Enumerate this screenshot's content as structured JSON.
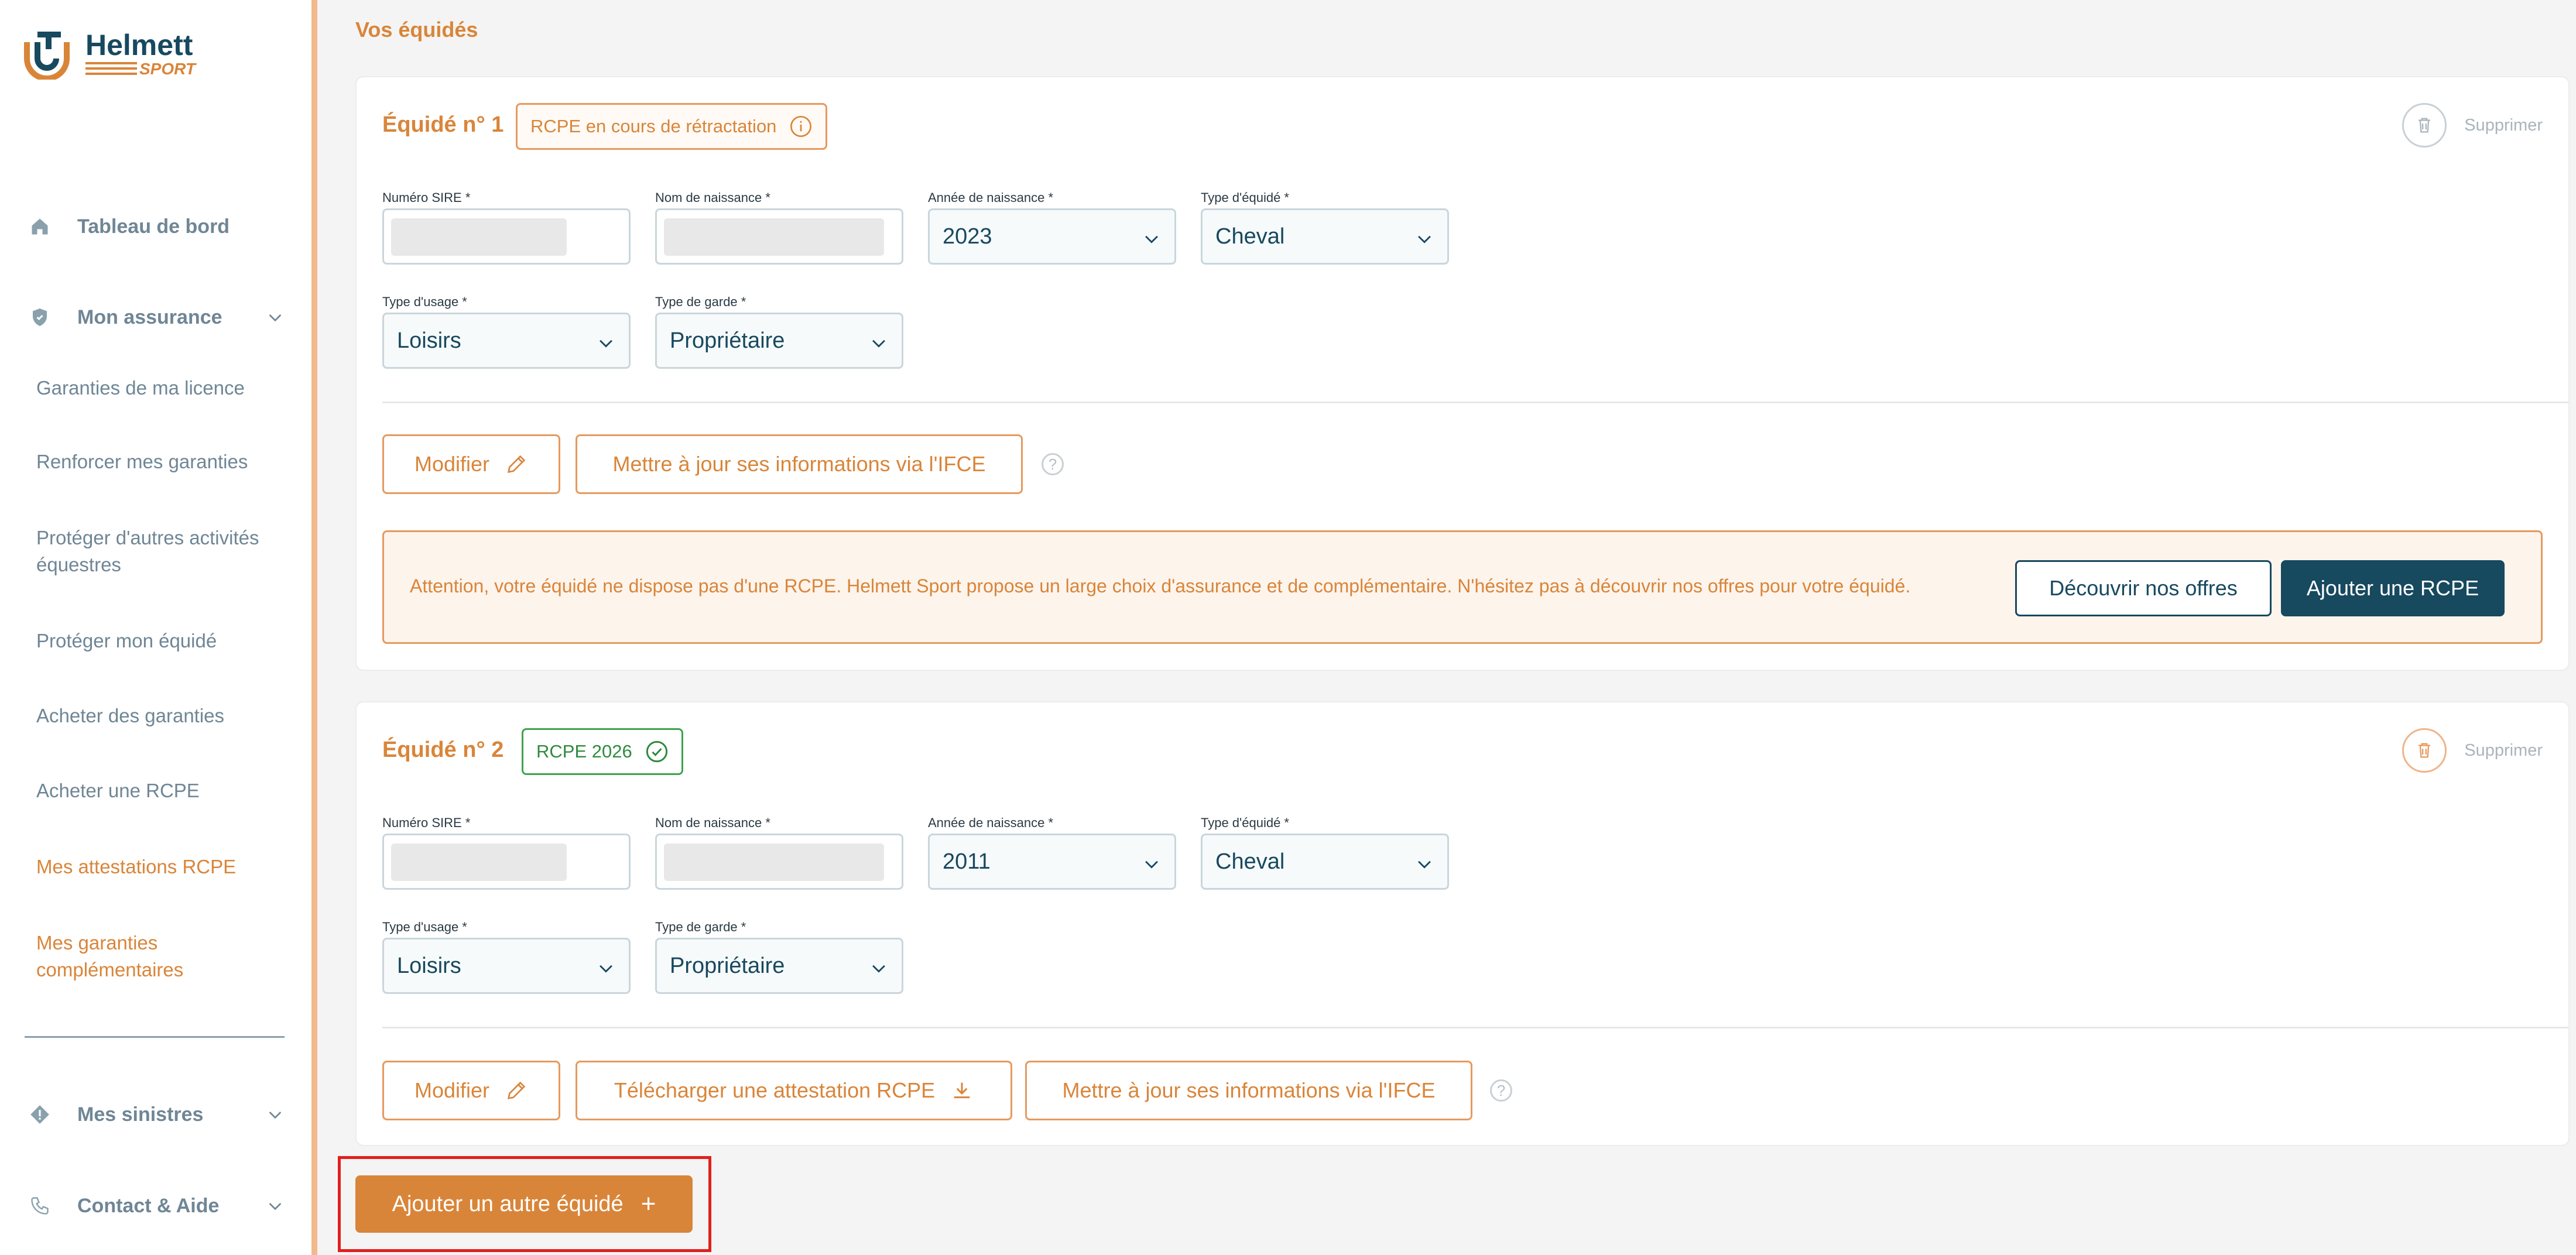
{
  "brand": {
    "name": "Helmett",
    "sub": "SPORT",
    "colors": {
      "orange": "#d98539",
      "teal": "#17495f"
    }
  },
  "sidebar": {
    "nav": {
      "dashboard": "Tableau de bord",
      "insurance": "Mon assurance",
      "claims": "Mes sinistres",
      "contact": "Contact & Aide"
    },
    "sub": [
      "Garanties de ma licence",
      "Renforcer mes garanties",
      "Protéger d'autres activités équestres",
      "Protéger mon équidé",
      "Acheter des garanties",
      "Acheter une RCPE",
      "Mes attestations RCPE",
      "Mes garanties complémentaires"
    ],
    "active_index": 6
  },
  "main": {
    "title": "Vos équidés",
    "labels": {
      "sire": "Numéro SIRE *",
      "birth_name": "Nom de naissance *",
      "birth_year": "Année de naissance *",
      "type": "Type d'équidé *",
      "usage": "Type d'usage *",
      "guard": "Type de garde *"
    },
    "delete_label": "Supprimer",
    "help_glyph": "?",
    "equides": [
      {
        "title": "Équidé n° 1",
        "badge": "RCPE en cours de rétractation",
        "birth_year": "2023",
        "type": "Cheval",
        "usage": "Loisirs",
        "guard": "Propriétaire",
        "btn_edit": "Modifier",
        "btn_ifce": "Mettre à jour ses informations via l'IFCE",
        "alert": "Attention, votre équidé ne dispose pas d'une RCPE. Helmett Sport propose un large choix d'assurance et de complémentaire. N'hésitez pas à découvrir nos offres pour votre équidé.",
        "btn_discover": "Découvrir nos offres",
        "btn_add_rcpe": "Ajouter une RCPE"
      },
      {
        "title": "Équidé n° 2",
        "badge": "RCPE 2026",
        "birth_year": "2011",
        "type": "Cheval",
        "usage": "Loisirs",
        "guard": "Propriétaire",
        "btn_edit": "Modifier",
        "btn_download": "Télécharger une attestation RCPE",
        "btn_ifce": "Mettre à jour ses informations via l'IFCE"
      }
    ],
    "add_button": "Ajouter un autre équidé",
    "add_glyph": "+"
  }
}
